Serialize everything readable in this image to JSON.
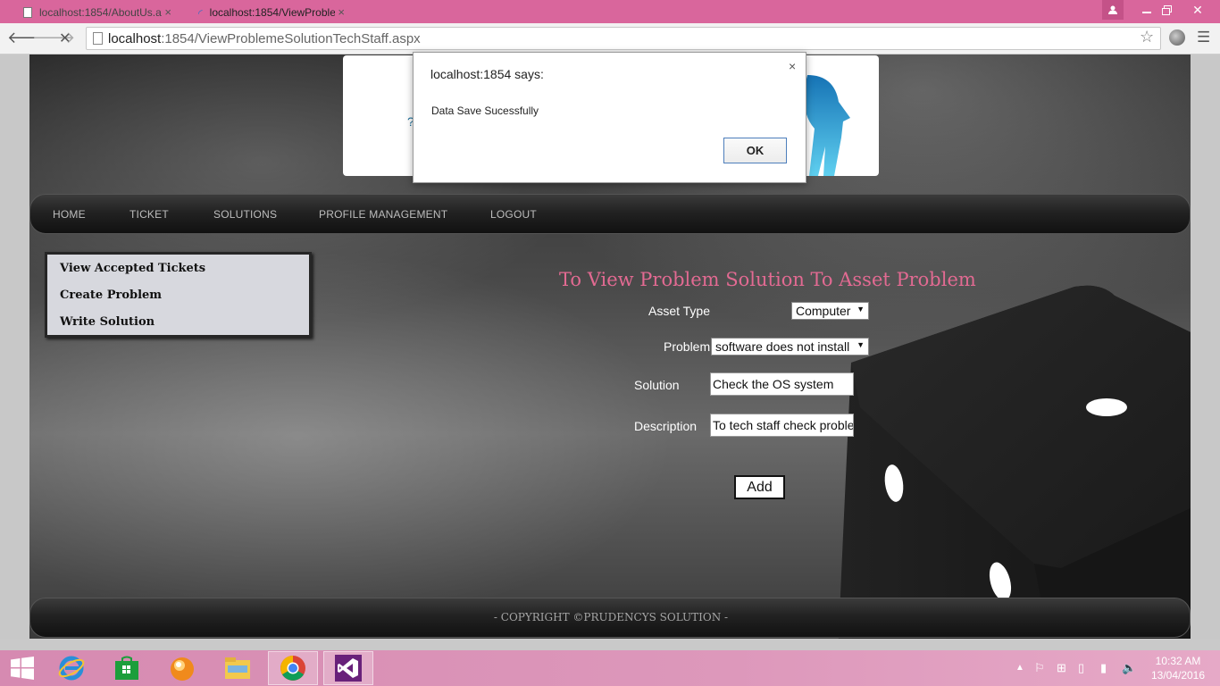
{
  "browser": {
    "tabs": [
      {
        "label": "localhost:1854/AboutUs.a",
        "close": "×"
      },
      {
        "label": "localhost:1854/ViewProble",
        "close": "×"
      }
    ],
    "url_host": "localhost",
    "url_path": ":1854/ViewProblemeSolutionTechStaff.aspx",
    "icons": [
      "back-icon",
      "forward-icon",
      "stop-icon",
      "star-icon",
      "menu-icon"
    ]
  },
  "nav": {
    "items": [
      "HOME",
      "TICKET",
      "SOLUTIONS",
      "PROFILE MANAGEMENT",
      "LOGOUT"
    ]
  },
  "sidebar": {
    "items": [
      "View Accepted Tickets",
      "Create Problem",
      "Write Solution"
    ]
  },
  "form": {
    "title": "To View Problem Solution To Asset Problem",
    "asset_type_label": "Asset Type",
    "asset_type_value": "Computer",
    "problem_label": "Problem",
    "problem_value": "software does not install",
    "solution_label": "Solution",
    "solution_value": "Check the OS system",
    "description_label": "Description",
    "description_value": "To tech staff check proble",
    "add_label": "Add"
  },
  "footer": {
    "text": "- COPYRIGHT ©PRUDENCYS SOLUTION -"
  },
  "dialog": {
    "title": "localhost:1854 says:",
    "message": "Data Save Sucessfully",
    "ok_label": "OK",
    "close": "×"
  },
  "taskbar": {
    "time": "10:32 AM",
    "date": "13/04/2016"
  }
}
